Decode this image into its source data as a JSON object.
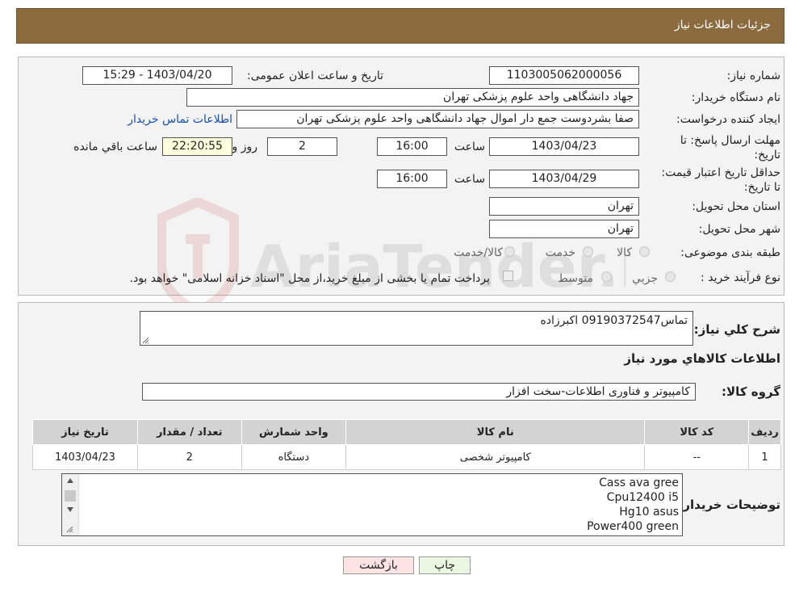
{
  "header": {
    "title": "جزئیات اطلاعات نیاز"
  },
  "form": {
    "need_number_label": "شماره نیاز:",
    "need_number": "1103005062000056",
    "announce_label": "تاریخ و ساعت اعلان عمومی:",
    "announce_value": "1403/04/20 - 15:29",
    "buyer_org_label": "نام دستگاه خریدار:",
    "buyer_org": "جهاد دانشگاهی واحد علوم پزشکی تهران",
    "requester_label": "ایجاد کننده درخواست:",
    "requester": "صفا بشردوست جمع دار اموال  جهاد دانشگاهی واحد علوم پزشکی تهران",
    "contact_link": "اطلاعات تماس خریدار",
    "reply_deadline_label": "مهلت ارسال پاسخ: تا تاریخ:",
    "reply_date": "1403/04/23",
    "time_label": "ساعت",
    "reply_time": "16:00",
    "days": "2",
    "days_label": "روز و",
    "remaining_time": "22:20:55",
    "remaining_label": "ساعت باقي مانده",
    "price_validity_label": "حداقل تاريخ اعتبار قيمت: تا تاريخ:",
    "price_date": "1403/04/29",
    "price_time": "16:00",
    "province_label": "استان محل تحویل:",
    "province": "تهران",
    "city_label": "شهر محل تحویل:",
    "city": "تهران",
    "category_label": "طبقه بندی موضوعی:",
    "category_options": [
      "کالا",
      "خدمت",
      "کالا/خدمت"
    ],
    "process_label": "نوع فرآیند خرید :",
    "process_options": [
      "جزیي",
      "متوسط"
    ],
    "payment_note": "پرداخت تمام یا بخشی از مبلغ خرید،از محل \"اسناد خزانه اسلامی\" خواهد بود."
  },
  "details": {
    "summary_label": "شرح کلي نياز:",
    "summary": "تماس09190372547 اکبرزاده",
    "goods_info_title": "اطلاعات کالاهاي مورد نياز",
    "goods_group_label": "گروه کالا:",
    "goods_group": "کامپیوتر و فناوری اطلاعات-سخت افزار",
    "table": {
      "headers": [
        "رديف",
        "کد کالا",
        "نام کالا",
        "واحد شمارش",
        "تعداد / مقدار",
        "تاريخ نياز"
      ],
      "rows": [
        [
          "1",
          "--",
          "کامپیوتر شخصی",
          "دستگاه",
          "2",
          "1403/04/23"
        ]
      ]
    },
    "buyer_notes_label": "توضيحات خريدار:",
    "buyer_notes": [
      "Cass ava gree",
      "Cpu12400 i5",
      "Hg10 asus",
      "Power400 green"
    ]
  },
  "buttons": {
    "print": "چاپ",
    "back": "بازگشت"
  },
  "watermark": {
    "brand": "AriaTender.neT"
  },
  "colors": {
    "header_bg": "#8b6b3d",
    "link": "#1a4fb5",
    "back_bg": "#fde3e3",
    "print_bg": "#eaf7e3"
  }
}
